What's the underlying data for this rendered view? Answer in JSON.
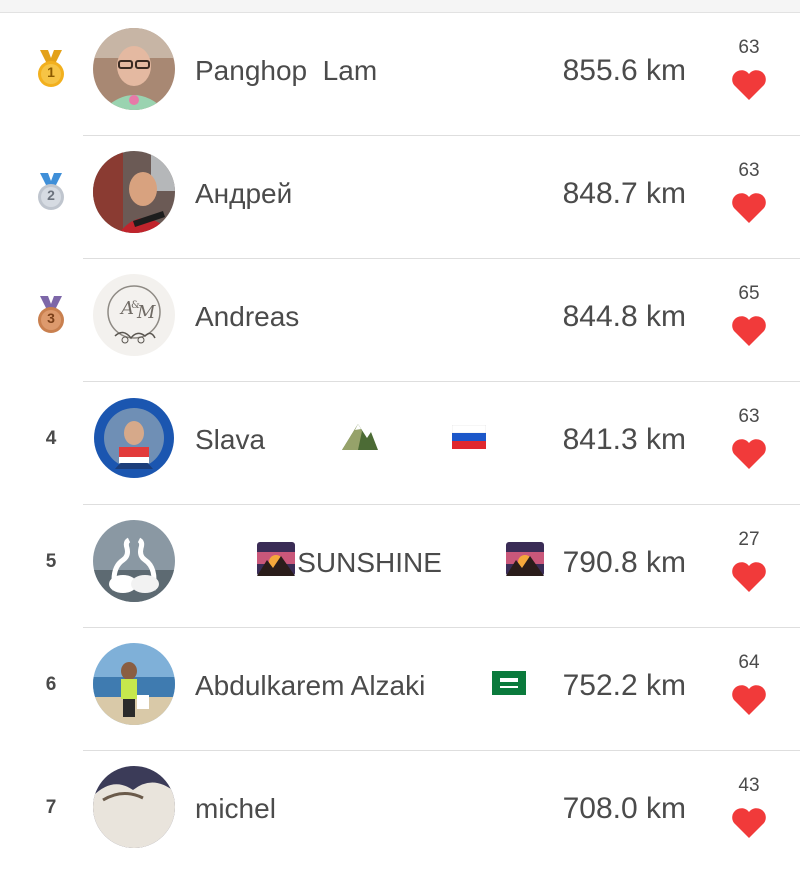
{
  "leaderboard": [
    {
      "rank": "1",
      "medal": "gold",
      "name": "Panghop  Lam",
      "distance": "855.6 km",
      "likes": "63"
    },
    {
      "rank": "2",
      "medal": "silver",
      "name": "Андрей",
      "distance": "848.7 km",
      "likes": "63"
    },
    {
      "rank": "3",
      "medal": "bronze",
      "name": "Andreas",
      "distance": "844.8 km",
      "likes": "65"
    },
    {
      "rank": "4",
      "medal": null,
      "name": "Slava",
      "distance": "841.3 km",
      "likes": "63"
    },
    {
      "rank": "5",
      "medal": null,
      "name": "SUNSHINE",
      "distance": "790.8 km",
      "likes": "27"
    },
    {
      "rank": "6",
      "medal": null,
      "name": "Abdulkarem Alzaki",
      "distance": "752.2 km",
      "likes": "64"
    },
    {
      "rank": "7",
      "medal": null,
      "name": "michel",
      "distance": "708.0 km",
      "likes": "43"
    }
  ],
  "colors": {
    "heart": "#f13a3a",
    "gold_medal": "#f2b01e",
    "silver_medal": "#c9ced6",
    "bronze_medal": "#cf8a5c",
    "divider": "#dedede"
  },
  "icons": [
    "gold-medal-icon",
    "silver-medal-icon",
    "bronze-medal-icon",
    "heart-icon",
    "mountain-emoji-icon",
    "russia-flag-icon",
    "sunset-emoji-icon",
    "saudi-flag-icon"
  ]
}
